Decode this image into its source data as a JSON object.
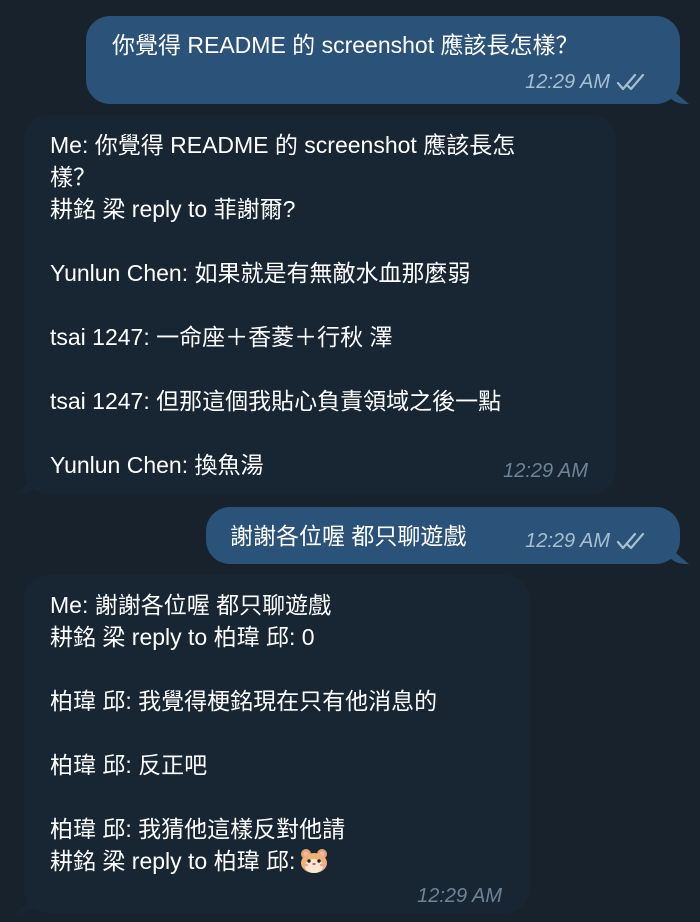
{
  "messages": [
    {
      "direction": "outgoing",
      "text": "你覺得 README 的 screenshot 應該長怎樣？",
      "time": "12:29 AM",
      "status": "read"
    },
    {
      "direction": "incoming",
      "lines": [
        "Me: 你覺得 README 的 screenshot 應該長怎",
        "樣？",
        "耕銘 梁 reply to 菲謝爾?",
        "",
        "Yunlun Chen: 如果就是有無敵水血那麼弱",
        "",
        "tsai 1247: 一命座＋香菱＋行秋 澤",
        "",
        "tsai 1247: 但那這個我貼心負責領域之後一點",
        "",
        "Yunlun Chen: 換魚湯"
      ],
      "time": "12:29 AM"
    },
    {
      "direction": "outgoing",
      "text": "謝謝各位喔 都只聊遊戲",
      "time": "12:29 AM",
      "status": "read"
    },
    {
      "direction": "incoming",
      "lines": [
        "Me: 謝謝各位喔 都只聊遊戲",
        "耕銘 梁 reply to 柏瑋 邱: 0",
        "",
        "柏瑋 邱: 我覺得梗銘現在只有他消息的",
        "",
        "柏瑋 邱: 反正吧",
        "",
        "柏瑋 邱: 我猜他這樣反對他請",
        "耕銘 梁 reply to 柏瑋 邱:"
      ],
      "emoji": "hamster-face",
      "time": "12:29 AM"
    }
  ],
  "colors": {
    "background": "#18222d",
    "outgoing_bubble": "#2b5278",
    "incoming_bubble": "#182533",
    "outgoing_meta": "#a6bfd3",
    "incoming_meta": "#6f8396",
    "text": "#ffffff"
  }
}
